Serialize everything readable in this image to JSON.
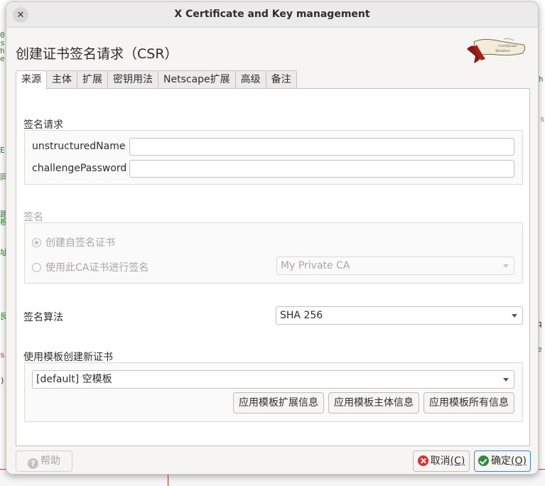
{
  "window": {
    "title": "X Certificate and Key management",
    "close_glyph": "✕"
  },
  "heading": "创建证书签名请求（CSR）",
  "logo": {
    "icon": "xca-scroll-logo"
  },
  "tabs": [
    "来源",
    "主体",
    "扩展",
    "密钥用法",
    "Netscape扩展",
    "高级",
    "备注"
  ],
  "sign_request": {
    "label": "签名请求",
    "unstructured_name_label": "unstructuredName",
    "unstructured_name_value": "",
    "challenge_password_label": "challengePassword",
    "challenge_password_value": ""
  },
  "signing": {
    "label": "签名",
    "self_signed_label": "创建自签名证书",
    "use_ca_label": "使用此CA证书进行签名",
    "ca_select_value": "My Private CA"
  },
  "algorithm": {
    "label": "签名算法",
    "value": "SHA 256"
  },
  "template": {
    "label": "使用模板创建新证书",
    "value": "[default] 空模板",
    "apply_extensions": "应用模板扩展信息",
    "apply_subject": "应用模板主体信息",
    "apply_all": "应用模板所有信息"
  },
  "buttons": {
    "help": "帮助",
    "help_icon": "?",
    "cancel": "取消",
    "cancel_key": "(C)",
    "ok": "确定",
    "ok_key": "(O)"
  },
  "colors": {
    "accent": "#3584e4",
    "cancel": "#d9302c",
    "ok": "#2e8b3e"
  }
}
